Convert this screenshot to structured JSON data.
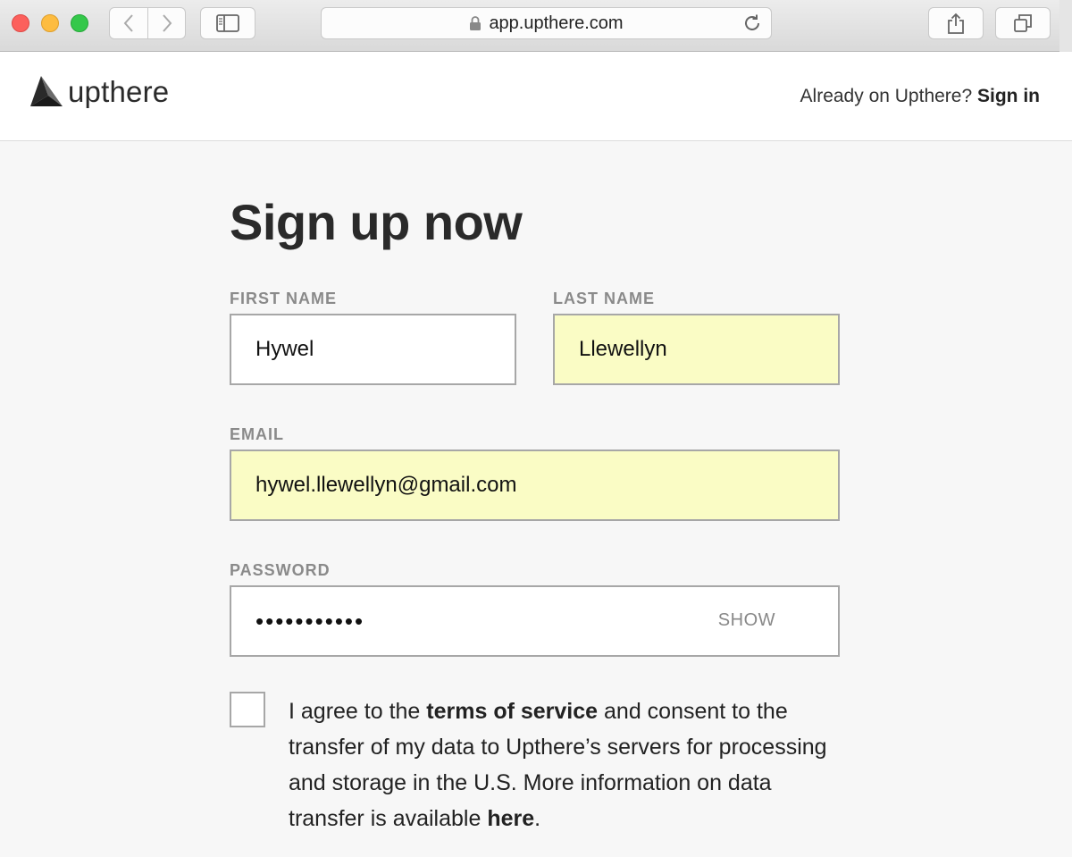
{
  "browser": {
    "url": "app.upthere.com",
    "icons": [
      "chevron-left-icon",
      "chevron-right-icon",
      "sidebar-icon",
      "lock-icon",
      "reload-icon",
      "share-icon",
      "tabs-icon"
    ]
  },
  "header": {
    "logo_text": "upthere",
    "signin_prompt": "Already on Upthere?",
    "signin_link": "Sign in"
  },
  "form": {
    "title": "Sign up now",
    "first_name": {
      "label": "FIRST NAME",
      "value": "Hywel"
    },
    "last_name": {
      "label": "LAST NAME",
      "value": "Llewellyn"
    },
    "email": {
      "label": "EMAIL",
      "value": "hywel.llewellyn@gmail.com"
    },
    "password": {
      "label": "PASSWORD",
      "value": "•••••••••••",
      "show_label": "SHOW"
    },
    "consent": {
      "text_1": "I agree to the",
      "terms_link": "terms of service",
      "text_2": "and consent to the transfer of my data to Upthere’s servers for processing and storage in the U.S. More information on data transfer is available",
      "here_link": "here",
      "text_3": "."
    }
  },
  "colors": {
    "autofill": "#fafcc5",
    "background": "#f7f7f7",
    "label": "#8a8a8a"
  }
}
